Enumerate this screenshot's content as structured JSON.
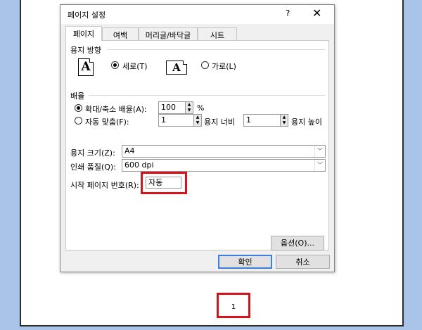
{
  "dialog": {
    "title": "페이지 설정",
    "help": "?",
    "close": "✕"
  },
  "tabs": [
    "페이지",
    "여백",
    "머리글/바닥글",
    "시트"
  ],
  "orientation": {
    "heading": "용지 방향",
    "portrait": "세로(T)",
    "landscape": "가로(L)",
    "icon_letter": "A"
  },
  "scaling": {
    "heading": "배율",
    "adjust_label": "확대/축소 배율(A):",
    "adjust_value": "100",
    "percent": "%",
    "fit_label": "자동 맞춤(F):",
    "fit_wide_value": "1",
    "fit_wide_label": "용지 너비",
    "fit_tall_value": "1",
    "fit_tall_label": "용지 높이"
  },
  "paper_size": {
    "label": "용지 크기(Z):",
    "value": "A4"
  },
  "print_quality": {
    "label": "인쇄 품질(Q):",
    "value": "600 dpi"
  },
  "first_page": {
    "label": "시작 페이지 번호(R):",
    "value": "자동"
  },
  "buttons": {
    "options": "옵션(O)...",
    "ok": "확인",
    "cancel": "취소"
  },
  "page_number": "1",
  "colors": {
    "highlight": "#d9121a",
    "background": "#a9c4e8"
  }
}
